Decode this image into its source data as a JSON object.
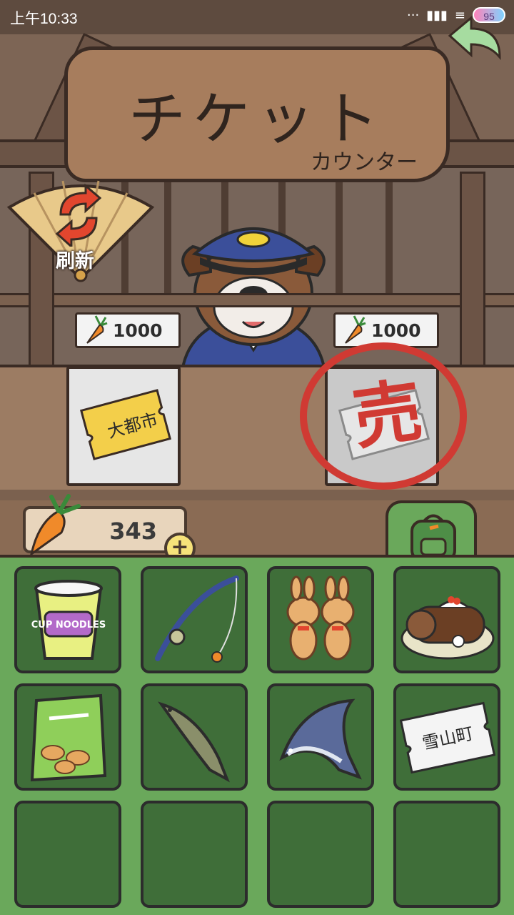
{
  "status_bar": {
    "time": "上午10:33",
    "battery": "95",
    "icons": [
      "more-dots-icon",
      "signal-icon",
      "wifi-icon"
    ]
  },
  "sign": {
    "title": "チケット",
    "subtitle": "カウンター"
  },
  "refresh_button": {
    "label": "刷新",
    "icon": "refresh-arrows-icon"
  },
  "shop": {
    "items": [
      {
        "price": "1000",
        "currency_icon": "carrot-icon",
        "ticket_destination": "大都市",
        "sold": false
      },
      {
        "price": "1000",
        "currency_icon": "carrot-icon",
        "ticket_destination": "",
        "sold": true,
        "sold_label": "売"
      }
    ]
  },
  "wallet": {
    "carrots": "343",
    "add_label": "+"
  },
  "inventory_tab": {
    "icon": "backpack-icon"
  },
  "inventory": {
    "items": [
      {
        "name": "cup-noodles",
        "label": "CUP NOODLES"
      },
      {
        "name": "fishing-rod",
        "label": ""
      },
      {
        "name": "bunny-cookies",
        "label": ""
      },
      {
        "name": "yule-log-cake",
        "label": ""
      },
      {
        "name": "snack-bag",
        "label": ""
      },
      {
        "name": "trout",
        "label": ""
      },
      {
        "name": "tuna",
        "label": ""
      },
      {
        "name": "ticket-snow-mountain",
        "label": "雪山町"
      },
      {
        "name": "empty",
        "label": ""
      },
      {
        "name": "empty",
        "label": ""
      },
      {
        "name": "empty",
        "label": ""
      },
      {
        "name": "empty",
        "label": ""
      }
    ]
  },
  "colors": {
    "inventory_bg": "#6aa85b",
    "cell_bg": "#3f6e39",
    "stamp_red": "#d03a33",
    "wood": "#a77d5d"
  }
}
